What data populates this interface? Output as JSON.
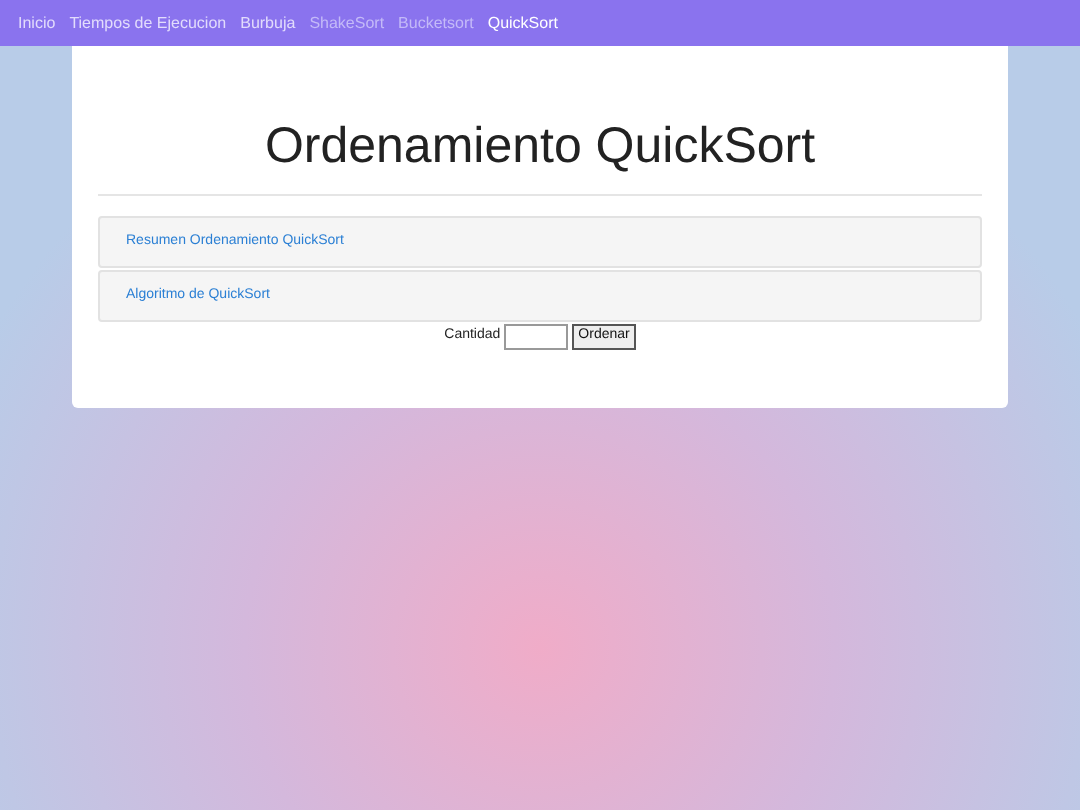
{
  "nav": {
    "items": [
      {
        "label": "Inicio",
        "selected": false,
        "disabled": false
      },
      {
        "label": "Tiempos de Ejecucion",
        "selected": false,
        "disabled": false
      },
      {
        "label": "Burbuja",
        "selected": false,
        "disabled": false
      },
      {
        "label": "ShakeSort",
        "selected": false,
        "disabled": true
      },
      {
        "label": "Bucketsort",
        "selected": false,
        "disabled": true
      },
      {
        "label": "QuickSort",
        "selected": true,
        "disabled": false
      }
    ]
  },
  "title": "Ordenamiento QuickSort",
  "panels": [
    {
      "label": "Resumen Ordenamiento QuickSort"
    },
    {
      "label": "Algoritmo de QuickSort"
    }
  ],
  "form": {
    "label": "Cantidad",
    "button": "Ordenar"
  }
}
